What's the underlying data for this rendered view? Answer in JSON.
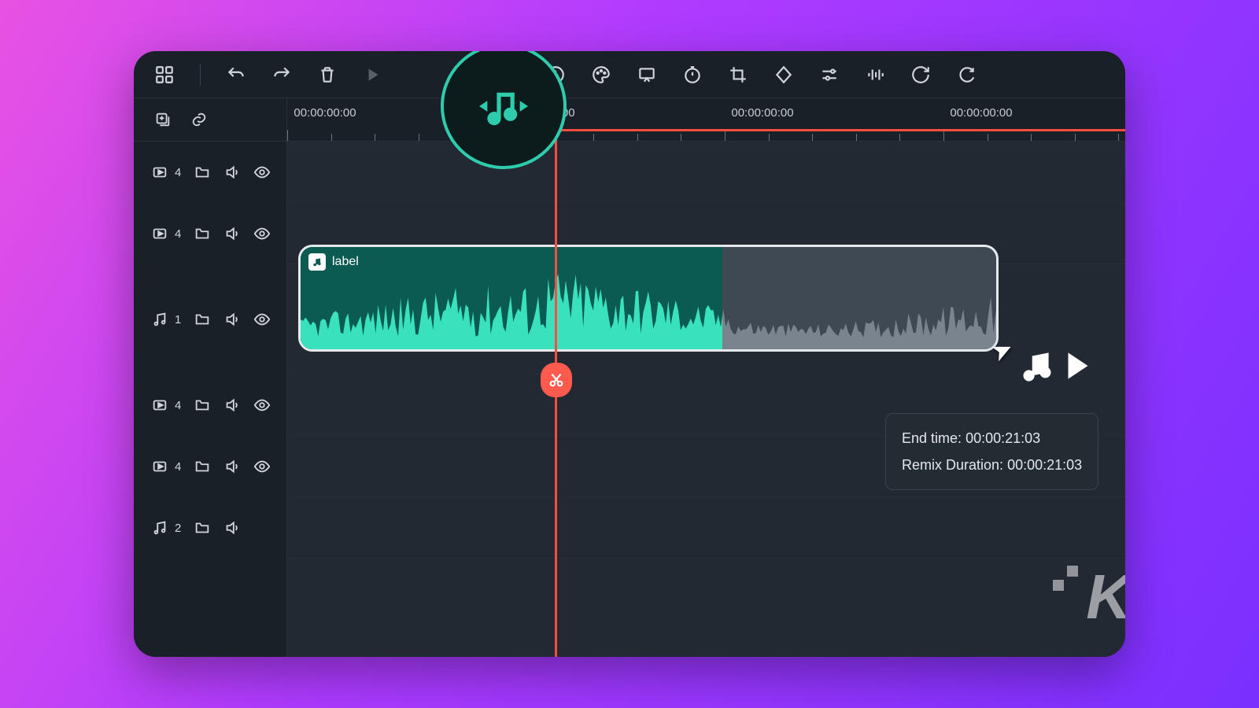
{
  "ruler": {
    "labels": [
      "00:00:00:00",
      "00:00:00:00",
      "00:00:00:00",
      "00:00:00:00"
    ]
  },
  "tracks": {
    "header_icons": [
      "add-track",
      "link"
    ],
    "rows": [
      {
        "type": "video",
        "index": "4"
      },
      {
        "type": "video",
        "index": "4"
      },
      {
        "type": "audio",
        "index": "1"
      },
      {
        "type": "video",
        "index": "4"
      },
      {
        "type": "video",
        "index": "4"
      },
      {
        "type": "audio",
        "index": "2"
      }
    ]
  },
  "clip": {
    "label": "label"
  },
  "tooltip": {
    "end_time_label": "End time:",
    "end_time_value": "00:00:21:03",
    "remix_label": "Remix Duration:",
    "remix_value": "00:00:21:03"
  },
  "watermark": "K",
  "colors": {
    "accent": "#2eccac",
    "playhead": "#ff4d3d"
  }
}
